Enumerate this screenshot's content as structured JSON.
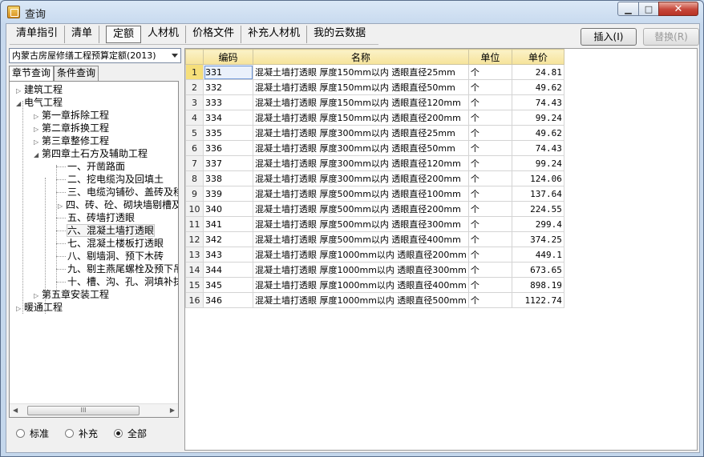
{
  "window": {
    "title": "查询"
  },
  "tabs": [
    {
      "label": "清单指引"
    },
    {
      "label": "清单"
    },
    {
      "label": "定额"
    },
    {
      "label": "人材机"
    },
    {
      "label": "价格文件"
    },
    {
      "label": "补充人材机"
    },
    {
      "label": "我的云数据"
    }
  ],
  "actions": {
    "insert": "插入(I)",
    "replace": "替换(R)"
  },
  "library": {
    "selected": "内蒙古房屋修缮工程预算定额(2013)"
  },
  "subtabs": [
    {
      "label": "章节查询"
    },
    {
      "label": "条件查询"
    }
  ],
  "tree": [
    {
      "label": "建筑工程"
    },
    {
      "label": "电气工程"
    },
    {
      "label": "第一章拆除工程"
    },
    {
      "label": "第二章拆换工程"
    },
    {
      "label": "第三章整修工程"
    },
    {
      "label": "第四章土石方及辅助工程"
    },
    {
      "label": "一、开凿路面"
    },
    {
      "label": "二、挖电缆沟及回填土"
    },
    {
      "label": "三、电缆沟铺砂、盖砖及移"
    },
    {
      "label": "四、砖、砼、砌块墙剔槽及"
    },
    {
      "label": "五、砖墙打透眼"
    },
    {
      "label": "六、混凝土墙打透眼"
    },
    {
      "label": "七、混凝土楼板打透眼"
    },
    {
      "label": "八、剔墙洞、预下木砖"
    },
    {
      "label": "九、剔主燕尾螺栓及预下吊"
    },
    {
      "label": "十、槽、沟、孔、洞填补抹"
    },
    {
      "label": "第五章安装工程"
    },
    {
      "label": "暖通工程"
    }
  ],
  "radios": [
    {
      "label": "标准",
      "checked": false
    },
    {
      "label": "补充",
      "checked": false
    },
    {
      "label": "全部",
      "checked": true
    }
  ],
  "scroll_thumb": "III",
  "grid": {
    "columns": [
      "编码",
      "名称",
      "单位",
      "单价"
    ],
    "rows": [
      {
        "n": "1",
        "code": "331",
        "name": "混凝土墙打透眼 厚度150mm以内 透眼直径25mm",
        "unit": "个",
        "price": "24.81"
      },
      {
        "n": "2",
        "code": "332",
        "name": "混凝土墙打透眼 厚度150mm以内 透眼直径50mm",
        "unit": "个",
        "price": "49.62"
      },
      {
        "n": "3",
        "code": "333",
        "name": "混凝土墙打透眼 厚度150mm以内 透眼直径120mm",
        "unit": "个",
        "price": "74.43"
      },
      {
        "n": "4",
        "code": "334",
        "name": "混凝土墙打透眼 厚度150mm以内 透眼直径200mm",
        "unit": "个",
        "price": "99.24"
      },
      {
        "n": "5",
        "code": "335",
        "name": "混凝土墙打透眼 厚度300mm以内 透眼直径25mm",
        "unit": "个",
        "price": "49.62"
      },
      {
        "n": "6",
        "code": "336",
        "name": "混凝土墙打透眼 厚度300mm以内 透眼直径50mm",
        "unit": "个",
        "price": "74.43"
      },
      {
        "n": "7",
        "code": "337",
        "name": "混凝土墙打透眼 厚度300mm以内 透眼直径120mm",
        "unit": "个",
        "price": "99.24"
      },
      {
        "n": "8",
        "code": "338",
        "name": "混凝土墙打透眼 厚度300mm以内 透眼直径200mm",
        "unit": "个",
        "price": "124.06"
      },
      {
        "n": "9",
        "code": "339",
        "name": "混凝土墙打透眼 厚度500mm以内 透眼直径100mm",
        "unit": "个",
        "price": "137.64"
      },
      {
        "n": "10",
        "code": "340",
        "name": "混凝土墙打透眼 厚度500mm以内 透眼直径200mm",
        "unit": "个",
        "price": "224.55"
      },
      {
        "n": "11",
        "code": "341",
        "name": "混凝土墙打透眼 厚度500mm以内 透眼直径300mm",
        "unit": "个",
        "price": "299.4"
      },
      {
        "n": "12",
        "code": "342",
        "name": "混凝土墙打透眼 厚度500mm以内 透眼直径400mm",
        "unit": "个",
        "price": "374.25"
      },
      {
        "n": "13",
        "code": "343",
        "name": "混凝土墙打透眼 厚度1000mm以内 透眼直径200mm",
        "unit": "个",
        "price": "449.1"
      },
      {
        "n": "14",
        "code": "344",
        "name": "混凝土墙打透眼 厚度1000mm以内 透眼直径300mm",
        "unit": "个",
        "price": "673.65"
      },
      {
        "n": "15",
        "code": "345",
        "name": "混凝土墙打透眼 厚度1000mm以内 透眼直径400mm",
        "unit": "个",
        "price": "898.19"
      },
      {
        "n": "16",
        "code": "346",
        "name": "混凝土墙打透眼 厚度1000mm以内 透眼直径500mm",
        "unit": "个",
        "price": "1122.74"
      }
    ]
  }
}
